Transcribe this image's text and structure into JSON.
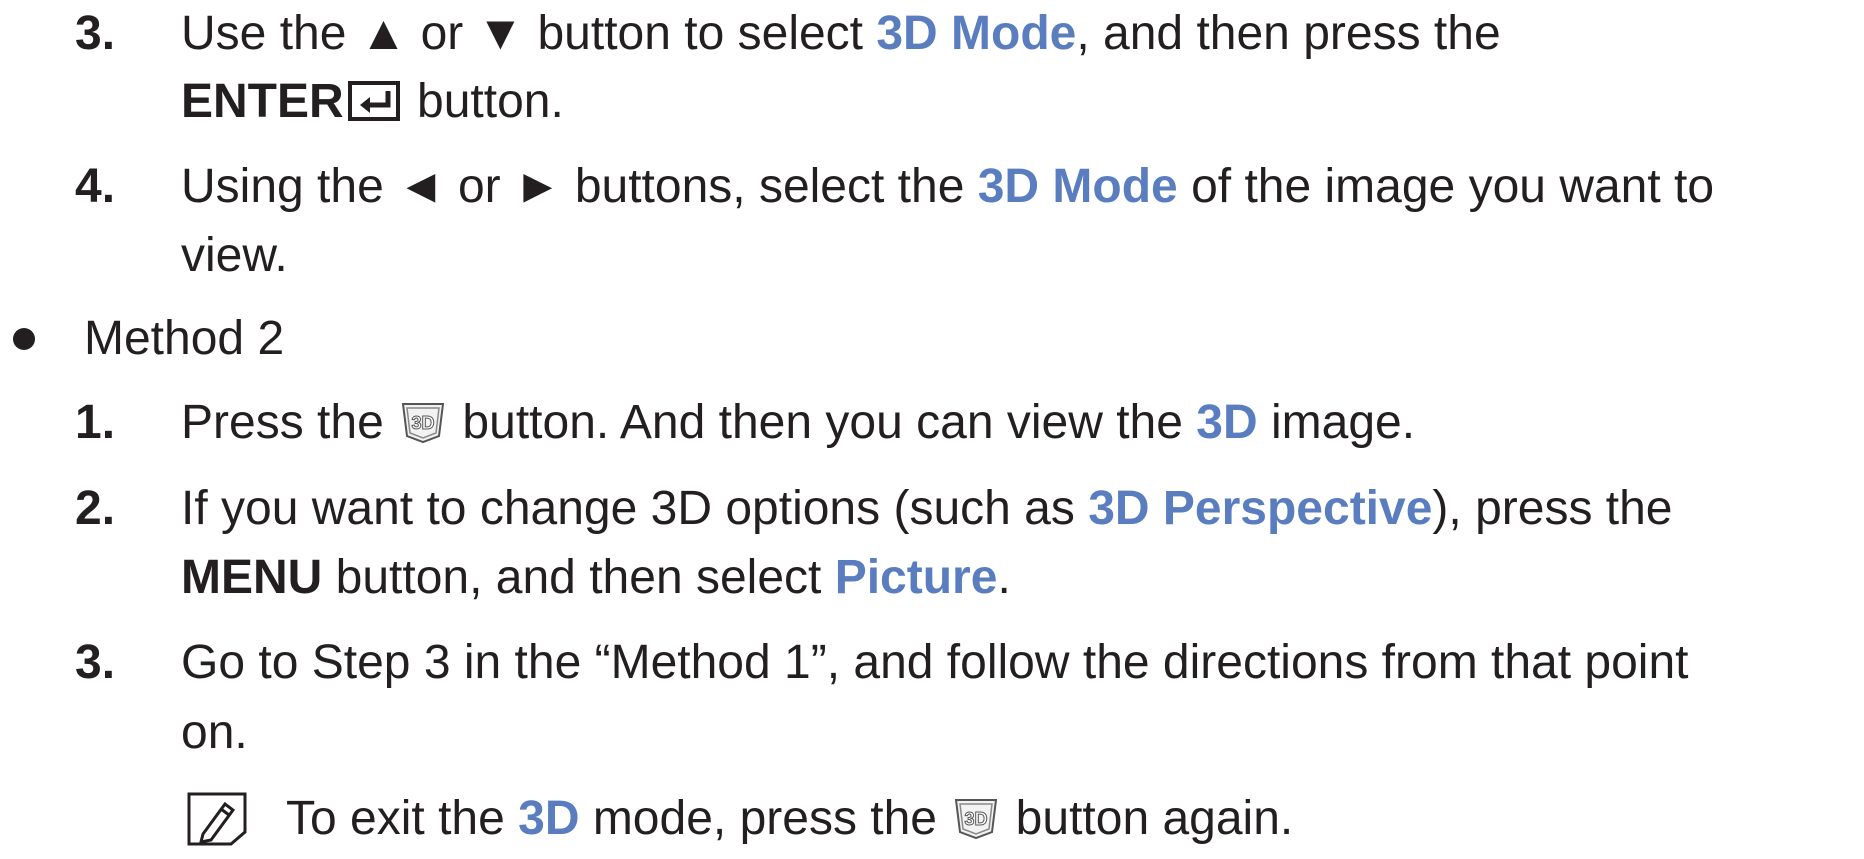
{
  "method1_steps": {
    "s3": {
      "num": "3.",
      "line1_a": "Use the ▲ or ▼ button to select ",
      "line1_hl": "3D Mode",
      "line1_b": ", and then press the",
      "line2_bold": "ENTER",
      "line2_b": " button."
    },
    "s4": {
      "num": "4.",
      "line1_a": "Using the ◄ or ► buttons, select the ",
      "line1_hl": "3D Mode",
      "line1_b": " of the image you want to",
      "line2": "view."
    }
  },
  "method2": {
    "label": "Method 2",
    "s1": {
      "num": "1.",
      "a": "Press the ",
      "b": " button. And then you can view the ",
      "hl": "3D",
      "c": " image."
    },
    "s2": {
      "num": "2.",
      "line1_a": "If you want to change 3D options (such as ",
      "line1_hl": "3D Perspective",
      "line1_b": "), press the",
      "line2_bold": "MENU",
      "line2_a": " button, and then select ",
      "line2_hl": "Picture",
      "line2_b": "."
    },
    "s3": {
      "num": "3.",
      "line1": "Go to Step 3 in the “Method 1”, and follow the directions from that point",
      "line2": "on."
    },
    "note": {
      "a": "To exit the ",
      "hl": "3D",
      "b": " mode, press the ",
      "c": " button again."
    }
  },
  "icons": {
    "enter": "enter-key-icon",
    "three_d": "3d-button-icon",
    "note": "note-pencil-icon"
  },
  "colors": {
    "text": "#231f20",
    "highlight": "#5a7dbf"
  }
}
